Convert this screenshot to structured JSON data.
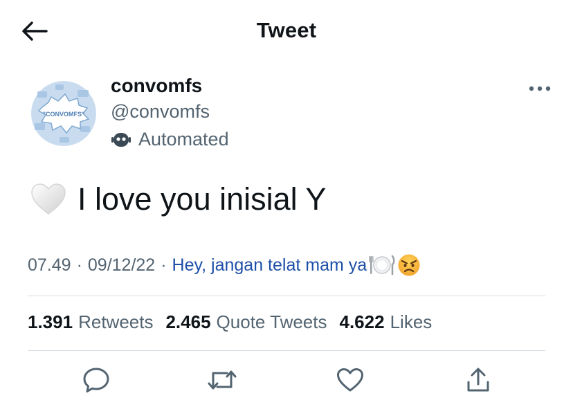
{
  "header": {
    "title": "Tweet",
    "back_icon": "arrow-left-icon"
  },
  "author": {
    "display_name": "convomfs",
    "handle": "@convomfs",
    "automated_label": "Automated",
    "avatar_text": "\"CONVOMFS\"",
    "avatar_colors": {
      "background": "#c9dcef",
      "burst": "#ffffff",
      "accent": "#7fa8d2"
    }
  },
  "tweet": {
    "emoji": "white-heart",
    "text": "I love you inisial Y"
  },
  "meta": {
    "time": "07.49",
    "date": "09/12/22",
    "separator": "·",
    "source": "Hey, jangan telat mam ya",
    "source_emojis": [
      "plate-with-cutlery",
      "angry-face"
    ]
  },
  "stats": [
    {
      "count": "1.391",
      "label": "Retweets"
    },
    {
      "count": "2.465",
      "label": "Quote Tweets"
    },
    {
      "count": "4.622",
      "label": "Likes"
    }
  ],
  "actions": {
    "reply_icon": "reply-icon",
    "retweet_icon": "retweet-icon",
    "like_icon": "heart-icon",
    "share_icon": "share-icon"
  },
  "colors": {
    "text_primary": "#0f1419",
    "text_secondary": "#536471",
    "source_link": "#1d4fa8",
    "divider": "#d5dbe0"
  }
}
